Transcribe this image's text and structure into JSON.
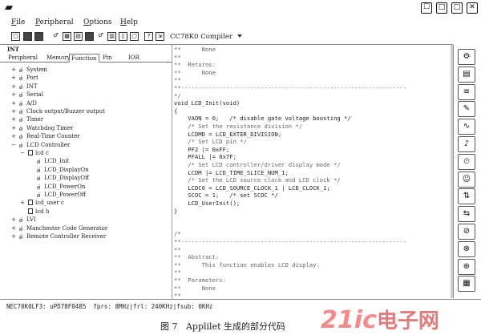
{
  "window": {
    "left_icon": "▰",
    "buttons": [
      "☐",
      "□",
      "□",
      "✕"
    ]
  },
  "menu": [
    "File",
    "Peripheral",
    "Options",
    "Help"
  ],
  "toolbar": {
    "compiler": "CC78K0 Compiler"
  },
  "left_panel": {
    "title": "INT",
    "tabs": [
      "Peripheral",
      "Memory",
      "Function",
      "Pin",
      "IOR"
    ],
    "tree": [
      {
        "label": "System",
        "depth": 0,
        "exp": "+"
      },
      {
        "label": "Port",
        "depth": 0,
        "exp": "+"
      },
      {
        "label": "INT",
        "depth": 0,
        "exp": "+"
      },
      {
        "label": "Serial",
        "depth": 0,
        "exp": "+"
      },
      {
        "label": "A/D",
        "depth": 0,
        "exp": "+"
      },
      {
        "label": "Clock output/Buzzer output",
        "depth": 0,
        "exp": "+"
      },
      {
        "label": "Timer",
        "depth": 0,
        "exp": "+"
      },
      {
        "label": "Watchdog Timer",
        "depth": 0,
        "exp": "+"
      },
      {
        "label": "Real-Time Counter",
        "depth": 0,
        "exp": "+"
      },
      {
        "label": "LCD Controller",
        "depth": 0,
        "exp": "−"
      },
      {
        "label": "lcd c",
        "depth": 1,
        "exp": "−"
      },
      {
        "label": "LCD_Init",
        "depth": 2,
        "exp": ""
      },
      {
        "label": "LCD_DisplayOn",
        "depth": 2,
        "exp": ""
      },
      {
        "label": "LCD_DisplayOff",
        "depth": 2,
        "exp": ""
      },
      {
        "label": "LCD_PowerOn",
        "depth": 2,
        "exp": ""
      },
      {
        "label": "LCD_PowerOff",
        "depth": 2,
        "exp": ""
      },
      {
        "label": "lcd_user c",
        "depth": 1,
        "exp": "+"
      },
      {
        "label": "lcd h",
        "depth": 1,
        "exp": ""
      },
      {
        "label": "LVI",
        "depth": 0,
        "exp": "+"
      },
      {
        "label": "Manchester Code Generator",
        "depth": 0,
        "exp": "+"
      },
      {
        "label": "Remote Controller Receiver",
        "depth": 0,
        "exp": "+"
      }
    ]
  },
  "code": [
    "**      None",
    "**",
    "**  Returns:",
    "**      None",
    "**",
    "**-----------------------------------------------------------------",
    "*/",
    "void LCD_Init(void)",
    "{",
    "    VAON = 0;   /* disable gate voltage boosting */",
    "    /* Set the resistance division */",
    "    LCDMD = LCD_EXTER_DIVISION;",
    "    /* Set LCD pin */",
    "    PF2 |= 0xFF;",
    "    PFALL |= 0x7F;",
    "    /* Set LCD controller/driver display mode */",
    "    LCDM |= LCD_TIME_SLICE_NUM_1;",
    "    /* Set the LCD source clock and LCD clock */",
    "    LCDC0 = LCD_SOURCE_CLOCK_1 | LCD_CLOCK_1;",
    "    SCOC = 1;   /* set SCOC */",
    "    LCD_UserInit();",
    "}",
    "",
    "",
    "/*",
    "**-----------------------------------------------------------------",
    "**",
    "**  Abstract:",
    "**      This function enables LCD display.",
    "**",
    "**  Parameters:",
    "**      None",
    "**"
  ],
  "palette_icons": [
    "⚙",
    "▤",
    "≡",
    "✎",
    "∿",
    "♪",
    "⏲",
    "☺",
    "⇅",
    "⇆",
    "⊘",
    "⊗",
    "⊕",
    "▦"
  ],
  "status": "NEC78K0LF3: uPD78F0485  fprs: 8MHz|frl: 240KHz|fsub: 0KHz",
  "caption": "图 7   Applilet 生成的部分代码",
  "watermark": {
    "a": "21ic",
    "b": "电子网"
  }
}
